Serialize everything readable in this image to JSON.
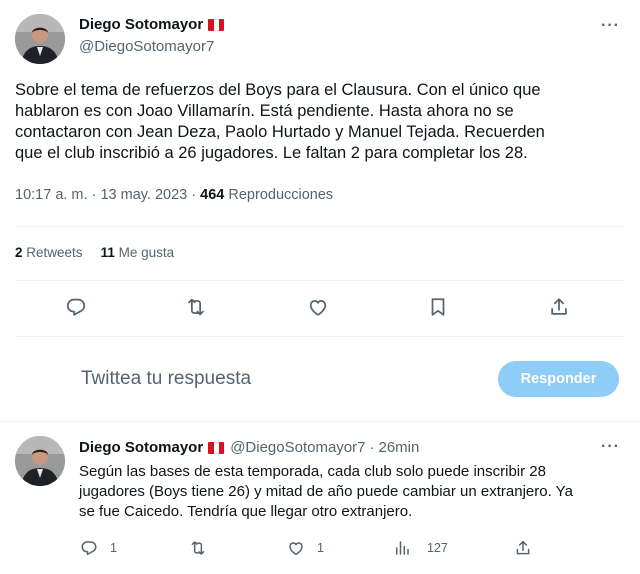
{
  "tweet": {
    "display_name": "Diego Sotomayor",
    "handle": "@DiegoSotomayor7",
    "text_lines": [
      "Sobre el tema de refuerzos del Boys para el Clausura. Con el único que",
      "hablaron es con Joao Villamarín. Está pendiente. Hasta ahora no se",
      "contactaron con Jean Deza, Paolo Hurtado y Manuel Tejada. Recuerden",
      "que el club inscribió a 26 jugadores. Le faltan 2 para completar los 28."
    ],
    "time": "10:17 a. m.",
    "sep1": "·",
    "date": "13 may. 2023",
    "sep2": "·",
    "views_count": "464",
    "views_label": "Reproducciones",
    "more": "···"
  },
  "stats": {
    "retweets_count": "2",
    "retweets_label": "Retweets",
    "likes_count": "11",
    "likes_label": "Me gusta"
  },
  "reply_box": {
    "placeholder": "Twittea tu respuesta",
    "button_label": "Responder"
  },
  "reply": {
    "display_name": "Diego Sotomayor",
    "handle": "@DiegoSotomayor7",
    "sep": "·",
    "time_ago": "26min",
    "more": "···",
    "text_lines": [
      "Según las bases de esta temporada, cada club solo puede inscribir 28",
      "jugadores (Boys tiene 26) y mitad de año puede cambiar un extranjero. Ya",
      "se fue Caicedo. Tendría que llegar otro extranjero."
    ],
    "reply_count": "1",
    "like_count": "1",
    "views_count": "127"
  },
  "icons": {
    "reply": "reply-icon",
    "retweet": "retweet-icon",
    "like": "heart-icon",
    "bookmark": "bookmark-icon",
    "share": "share-icon",
    "views": "views-icon"
  },
  "colors": {
    "text": "#0f1419",
    "secondary": "#536471",
    "button_disabled": "#8ecdf8",
    "divider": "#eff3f4"
  }
}
